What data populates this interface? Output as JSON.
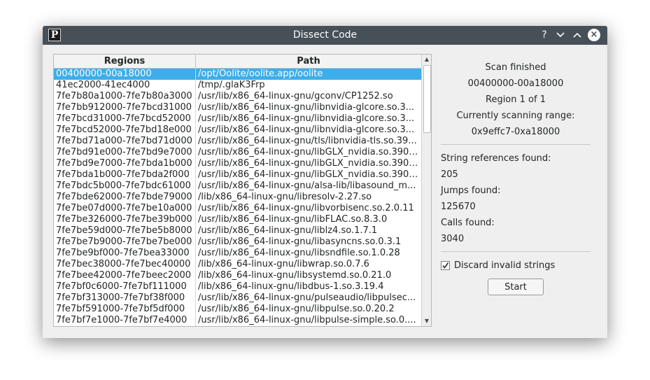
{
  "window": {
    "title": "Dissect Code",
    "icon_letter": "P",
    "buttons": {
      "help": "?",
      "close": "×"
    }
  },
  "table": {
    "headers": {
      "regions": "Regions",
      "path": "Path"
    },
    "selected_index": 0,
    "rows": [
      {
        "region": "00400000-00a18000",
        "path": "/opt/Oolite/oolite.app/oolite"
      },
      {
        "region": "41ec2000-41ec4000",
        "path": "/tmp/.glaK3Frp"
      },
      {
        "region": "7fe7b80a1000-7fe7b80a3000",
        "path": "/usr/lib/x86_64-linux-gnu/gconv/CP1252.so"
      },
      {
        "region": "7fe7bb912000-7fe7bcd31000",
        "path": "/usr/lib/x86_64-linux-gnu/libnvidia-glcore.so.3..."
      },
      {
        "region": "7fe7bcd31000-7fe7bcd52000",
        "path": "/usr/lib/x86_64-linux-gnu/libnvidia-glcore.so.3..."
      },
      {
        "region": "7fe7bcd52000-7fe7bd18e000",
        "path": "/usr/lib/x86_64-linux-gnu/libnvidia-glcore.so.3..."
      },
      {
        "region": "7fe7bd71a000-7fe7bd71d000",
        "path": "/usr/lib/x86_64-linux-gnu/tls/libnvidia-tls.so.39..."
      },
      {
        "region": "7fe7bd91e000-7fe7bd9e7000",
        "path": "/usr/lib/x86_64-linux-gnu/libGLX_nvidia.so.390...."
      },
      {
        "region": "7fe7bd9e7000-7fe7bda1b000",
        "path": "/usr/lib/x86_64-linux-gnu/libGLX_nvidia.so.390...."
      },
      {
        "region": "7fe7bda1b000-7fe7bda2f000",
        "path": "/usr/lib/x86_64-linux-gnu/libGLX_nvidia.so.390...."
      },
      {
        "region": "7fe7bdc5b000-7fe7bdc61000",
        "path": "/usr/lib/x86_64-linux-gnu/alsa-lib/libasound_m..."
      },
      {
        "region": "7fe7bde62000-7fe7bde79000",
        "path": "/lib/x86_64-linux-gnu/libresolv-2.27.so"
      },
      {
        "region": "7fe7be07d000-7fe7be10a000",
        "path": "/usr/lib/x86_64-linux-gnu/libvorbisenc.so.2.0.11"
      },
      {
        "region": "7fe7be326000-7fe7be39b000",
        "path": "/usr/lib/x86_64-linux-gnu/libFLAC.so.8.3.0"
      },
      {
        "region": "7fe7be59d000-7fe7be5b8000",
        "path": "/usr/lib/x86_64-linux-gnu/liblz4.so.1.7.1"
      },
      {
        "region": "7fe7be7b9000-7fe7be7be000",
        "path": "/usr/lib/x86_64-linux-gnu/libasyncns.so.0.3.1"
      },
      {
        "region": "7fe7be9bf000-7fe7bea33000",
        "path": "/usr/lib/x86_64-linux-gnu/libsndfile.so.1.0.28"
      },
      {
        "region": "7fe7bec38000-7fe7bec40000",
        "path": "/lib/x86_64-linux-gnu/libwrap.so.0.7.6"
      },
      {
        "region": "7fe7bee42000-7fe7beec2000",
        "path": "/lib/x86_64-linux-gnu/libsystemd.so.0.21.0"
      },
      {
        "region": "7fe7bf0c6000-7fe7bf111000",
        "path": "/lib/x86_64-linux-gnu/libdbus-1.so.3.19.4"
      },
      {
        "region": "7fe7bf313000-7fe7bf38f000",
        "path": "/usr/lib/x86_64-linux-gnu/pulseaudio/libpulsec..."
      },
      {
        "region": "7fe7bf591000-7fe7bf5df000",
        "path": "/usr/lib/x86_64-linux-gnu/libpulse.so.0.20.2"
      },
      {
        "region": "7fe7bf7e1000-7fe7bf7e4000",
        "path": "/usr/lib/x86_64-linux-gnu/libpulse-simple.so.0...."
      }
    ]
  },
  "status": {
    "scan_state": "Scan finished",
    "range": "00400000-00a18000",
    "region_progress": "Region 1 of 1",
    "scanning_label": "Currently scanning range:",
    "scanning_range": "0x9effc7-0xa18000"
  },
  "results": {
    "strings_label": "String references found:",
    "strings_value": "205",
    "jumps_label": "Jumps found:",
    "jumps_value": "125670",
    "calls_label": "Calls found:",
    "calls_value": "3040"
  },
  "options": {
    "discard_label": "Discard invalid strings",
    "discard_checked": true,
    "start_label": "Start"
  },
  "colors": {
    "titlebar": "#475057",
    "selection": "#3daee9",
    "window_bg": "#efefef"
  }
}
